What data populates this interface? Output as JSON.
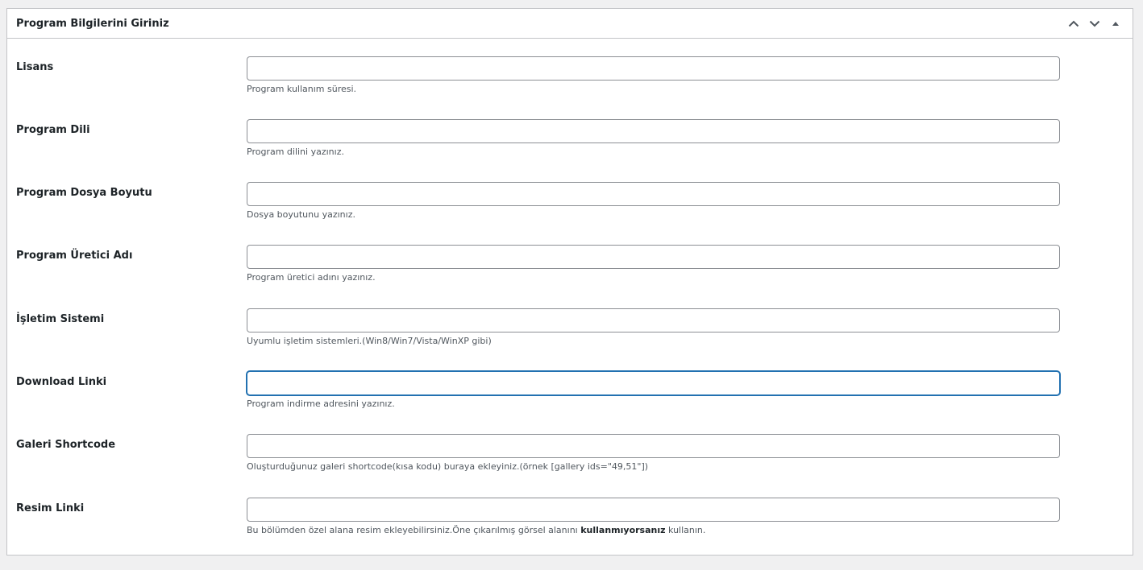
{
  "metabox": {
    "title": "Program Bilgilerini Giriniz",
    "icons": {
      "move_up": "chevron-up-icon",
      "move_down": "chevron-down-icon",
      "toggle": "caret-up-icon"
    }
  },
  "fields": [
    {
      "label": "Lisans",
      "value": "",
      "description": "Program kullanım süresi."
    },
    {
      "label": "Program Dili",
      "value": "",
      "description": "Program dilini yazınız."
    },
    {
      "label": "Program Dosya Boyutu",
      "value": "",
      "description": "Dosya boyutunu yazınız."
    },
    {
      "label": "Program Üretici Adı",
      "value": "",
      "description": "Program üretici adını yazınız."
    },
    {
      "label": "İşletim Sistemi",
      "value": "",
      "description": "Uyumlu işletim sistemleri.(Win8/Win7/Vista/WinXP gibi)"
    },
    {
      "label": "Download Linki",
      "value": "",
      "description": "Program indirme adresini yazınız.",
      "focused": true
    },
    {
      "label": "Galeri Shortcode",
      "value": "",
      "description": "Oluşturduğunuz galeri shortcode(kısa kodu) buraya ekleyiniz.(örnek [gallery ids=\"49,51\"])"
    },
    {
      "label": "Resim Linki",
      "value": "",
      "description_parts": {
        "before": "Bu bölümden özel alana resim ekleyebilirsiniz.Öne çıkarılmış görsel alanını ",
        "bold": "kullanmıyorsanız",
        "after": " kullanın."
      }
    }
  ],
  "colors": {
    "accent": "#2271b1",
    "border": "#c3c4c7",
    "background": "#f0f0f1"
  }
}
